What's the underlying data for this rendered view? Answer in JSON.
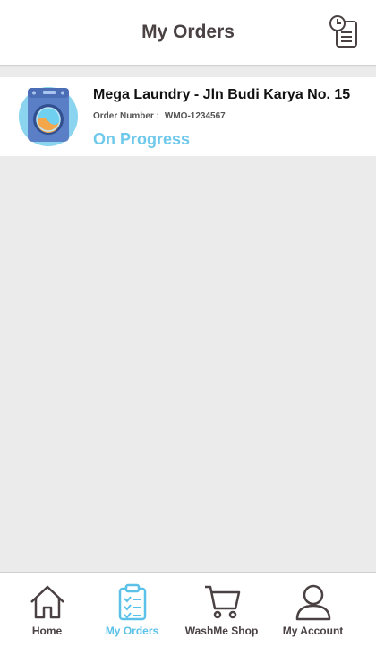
{
  "header": {
    "title": "My Orders",
    "history_icon": "history-clock-list-icon"
  },
  "orders": [
    {
      "shop": "Mega Laundry - Jln Budi Karya No. 15",
      "order_number_label": "Order Number :",
      "order_number": "WMO-1234567",
      "status": "On Progress",
      "icon": "washing-machine-icon"
    }
  ],
  "nav": {
    "items": [
      {
        "label": "Home",
        "icon": "home-icon",
        "active": false
      },
      {
        "label": "My Orders",
        "icon": "clipboard-checklist-icon",
        "active": true
      },
      {
        "label": "WashMe Shop",
        "icon": "shopping-cart-icon",
        "active": false
      },
      {
        "label": "My Account",
        "icon": "user-icon",
        "active": false
      }
    ]
  },
  "colors": {
    "accent": "#5bc1e8",
    "status": "#6fc9ea",
    "text_dark": "#4a4143",
    "background": "#ebebeb"
  }
}
